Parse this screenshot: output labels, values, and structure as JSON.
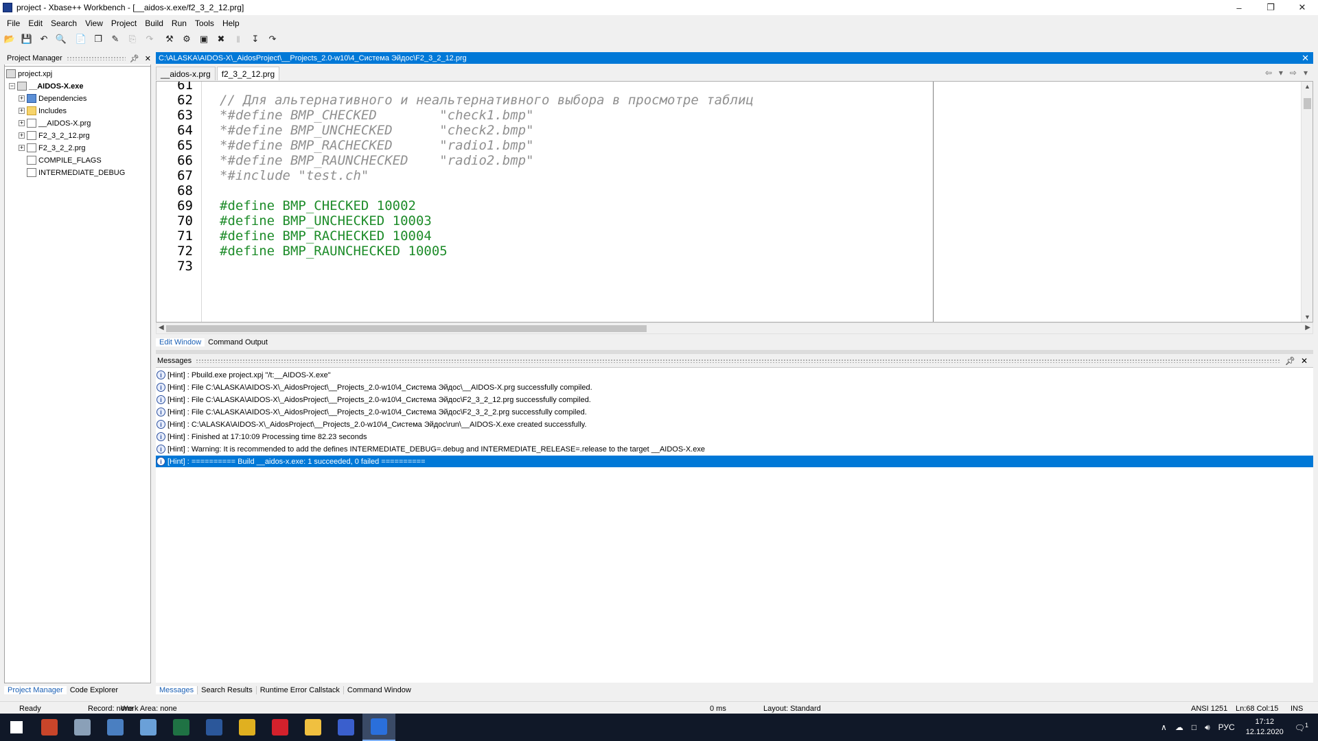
{
  "window": {
    "title": "project - Xbase++ Workbench - [__aidos-x.exe/f2_3_2_12.prg]",
    "controls": [
      "–",
      "❐",
      "✕"
    ]
  },
  "menu": [
    "File",
    "Edit",
    "Search",
    "View",
    "Project",
    "Build",
    "Run",
    "Tools",
    "Help"
  ],
  "toolbar": [
    {
      "name": "open-icon",
      "glyph": "📂"
    },
    {
      "name": "save-icon",
      "glyph": "💾"
    },
    {
      "name": "undo-icon",
      "glyph": "↶"
    },
    {
      "name": "find-icon",
      "glyph": "🔍"
    },
    {
      "name": "new-file-icon",
      "glyph": "📄"
    },
    {
      "name": "copy-icon",
      "glyph": "❐"
    },
    {
      "name": "edit-icon",
      "glyph": "✎"
    },
    {
      "name": "paste-icon",
      "glyph": "⎘"
    },
    {
      "name": "redo-icon",
      "glyph": "↷"
    },
    {
      "name": "build-icon",
      "glyph": "⚒"
    },
    {
      "name": "compile-icon",
      "glyph": "⚙"
    },
    {
      "name": "run-icon",
      "glyph": "▣"
    },
    {
      "name": "debug-icon",
      "glyph": "✖"
    },
    {
      "name": "pause-icon",
      "glyph": "‖"
    },
    {
      "name": "step-icon",
      "glyph": "↧"
    },
    {
      "name": "step-over-icon",
      "glyph": "↷"
    }
  ],
  "project_manager": {
    "title": "Project Manager",
    "nodes": [
      {
        "label": "project.xpj",
        "level": 0,
        "expander": "",
        "icon": "proj"
      },
      {
        "label": "__AIDOS-X.exe",
        "level": 1,
        "expander": "−",
        "icon": "proj",
        "bold": true
      },
      {
        "label": "Dependencies",
        "level": 2,
        "expander": "+",
        "icon": "dep"
      },
      {
        "label": "Includes",
        "level": 2,
        "expander": "+",
        "icon": "folder"
      },
      {
        "label": "__AIDOS-X.prg",
        "level": 2,
        "expander": "+",
        "icon": "file"
      },
      {
        "label": "F2_3_2_12.prg",
        "level": 2,
        "expander": "+",
        "icon": "file"
      },
      {
        "label": "F2_3_2_2.prg",
        "level": 2,
        "expander": "+",
        "icon": "file"
      },
      {
        "label": "COMPILE_FLAGS",
        "level": 2,
        "expander": "",
        "icon": "file"
      },
      {
        "label": "INTERMEDIATE_DEBUG",
        "level": 2,
        "expander": "",
        "icon": "file"
      }
    ],
    "tabs": [
      "Project Manager",
      "Code Explorer"
    ]
  },
  "editor": {
    "path": "C:\\ALASKA\\AIDOS-X\\_AidosProject\\__Projects_2.0-w10\\4_Система Эйдос\\F2_3_2_12.prg",
    "tabs": [
      "__aidos-x.prg",
      "f2_3_2_12.prg"
    ],
    "active_tab": 1,
    "lines": [
      {
        "num": "61",
        "text": "",
        "cls": ""
      },
      {
        "num": "62",
        "text": "// Для альтернативного и неальтернативного выбора в просмотре таблиц",
        "cls": "comment"
      },
      {
        "num": "63",
        "text": "*#define BMP_CHECKED        \"check1.bmp\"",
        "cls": "comment"
      },
      {
        "num": "64",
        "text": "*#define BMP_UNCHECKED      \"check2.bmp\"",
        "cls": "comment"
      },
      {
        "num": "65",
        "text": "*#define BMP_RACHECKED      \"radio1.bmp\"",
        "cls": "comment"
      },
      {
        "num": "66",
        "text": "*#define BMP_RAUNCHECKED    \"radio2.bmp\"",
        "cls": "comment"
      },
      {
        "num": "67",
        "text": "*#include \"test.ch\"",
        "cls": "comment"
      },
      {
        "num": "68",
        "text": "",
        "cls": ""
      },
      {
        "num": "69",
        "text": "#define BMP_CHECKED 10002",
        "cls": "def"
      },
      {
        "num": "70",
        "text": "#define BMP_UNCHECKED 10003",
        "cls": "def"
      },
      {
        "num": "71",
        "text": "#define BMP_RACHECKED 10004",
        "cls": "def"
      },
      {
        "num": "72",
        "text": "#define BMP_RAUNCHECKED 10005",
        "cls": "def"
      },
      {
        "num": "73",
        "text": "",
        "cls": ""
      }
    ],
    "subtabs": [
      "Edit Window",
      "Command Output"
    ]
  },
  "messages": {
    "title": "Messages",
    "items": [
      {
        "text": "[Hint] : Pbuild.exe project.xpj \"/t:__AIDOS-X.exe\"",
        "selected": false
      },
      {
        "text": "[Hint] : File C:\\ALASKA\\AIDOS-X\\_AidosProject\\__Projects_2.0-w10\\4_Система Эйдос\\__AIDOS-X.prg successfully compiled.",
        "selected": false
      },
      {
        "text": "[Hint] : File C:\\ALASKA\\AIDOS-X\\_AidosProject\\__Projects_2.0-w10\\4_Система Эйдос\\F2_3_2_12.prg successfully compiled.",
        "selected": false
      },
      {
        "text": "[Hint] : File C:\\ALASKA\\AIDOS-X\\_AidosProject\\__Projects_2.0-w10\\4_Система Эйдос\\F2_3_2_2.prg successfully compiled.",
        "selected": false
      },
      {
        "text": "[Hint] : C:\\ALASKA\\AIDOS-X\\_AidosProject\\__Projects_2.0-w10\\4_Система Эйдос\\run\\__AIDOS-X.exe created successfully.",
        "selected": false
      },
      {
        "text": "[Hint] : Finished at 17:10:09 Processing time 82.23 seconds",
        "selected": false
      },
      {
        "text": "[Hint] : Warning: It is recommended to add the defines INTERMEDIATE_DEBUG=.debug and INTERMEDIATE_RELEASE=.release to the target __AIDOS-X.exe",
        "selected": false
      },
      {
        "text": "[Hint] : ========== Build __aidos-x.exe: 1 succeeded, 0 failed ==========",
        "selected": true
      }
    ],
    "tabs": [
      "Messages",
      "Search Results",
      "Runtime Error Callstack",
      "Command Window"
    ]
  },
  "status": {
    "ready": "Ready",
    "record": "Record: none",
    "workarea": "Work Area: none",
    "ms": "0 ms",
    "layout": "Layout: Standard",
    "encoding": "ANSI 1251",
    "position": "Ln:68 Col:15",
    "mode": "INS"
  },
  "taskbar": {
    "apps": [
      {
        "name": "start-icon",
        "color": "#ffffff"
      },
      {
        "name": "winrar-icon",
        "color": "#c8452a"
      },
      {
        "name": "app-tray-icon",
        "color": "#8aa0b8"
      },
      {
        "name": "calculator-icon",
        "color": "#4a7fc1"
      },
      {
        "name": "app-globe-icon",
        "color": "#6aa0d8"
      },
      {
        "name": "excel-icon",
        "color": "#1f7244"
      },
      {
        "name": "word-icon",
        "color": "#2b579a"
      },
      {
        "name": "chrome-icon",
        "color": "#e0b020"
      },
      {
        "name": "opera-icon",
        "color": "#d3212c"
      },
      {
        "name": "explorer-icon",
        "color": "#f0c040"
      },
      {
        "name": "floppy-app-icon",
        "color": "#3a5fcd"
      },
      {
        "name": "workbench-icon",
        "color": "#2a6fdb"
      }
    ],
    "lang": "РУС",
    "time": "17:12",
    "date": "12.12.2020",
    "notifications": "1"
  }
}
